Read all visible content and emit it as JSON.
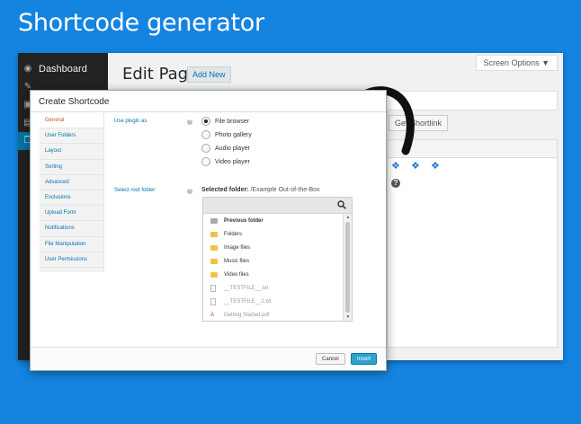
{
  "banner": {
    "title": "Shortcode generator"
  },
  "wp": {
    "sidebar": {
      "dashboard_label": "Dashboard"
    },
    "page_title": "Edit Page",
    "add_new_label": "Add New",
    "screen_options_label": "Screen Options ▼",
    "shortlink_label": "Get Shortlink"
  },
  "dialog": {
    "title": "Create Shortcode",
    "tabs": [
      "General",
      "User Folders",
      "Layout",
      "Sorting",
      "Advanced",
      "Exclusions",
      "Upload Form",
      "Notifications",
      "File Manipulation",
      "User Permissions"
    ],
    "use_plugin_label": "Use plugin as",
    "plugin_options": [
      "File browser",
      "Photo gallery",
      "Audio player",
      "Video player"
    ],
    "selected_option": "File browser",
    "select_root_label": "Select root folder",
    "selected_folder_label": "Selected folder:",
    "selected_folder_value": "/Example Out-of-the-Box",
    "files": [
      {
        "name": "Previous folder",
        "type": "prev"
      },
      {
        "name": "Folders",
        "type": "folder"
      },
      {
        "name": "Image files",
        "type": "folder"
      },
      {
        "name": "Music files",
        "type": "folder"
      },
      {
        "name": "Video files",
        "type": "folder"
      },
      {
        "name": "__TESTFILE__.txt",
        "type": "doc"
      },
      {
        "name": "__TESTFILE__2.txt",
        "type": "doc"
      },
      {
        "name": "Getting Started.pdf",
        "type": "pdf"
      }
    ],
    "cancel_label": "Cancel",
    "insert_label": "Insert"
  }
}
